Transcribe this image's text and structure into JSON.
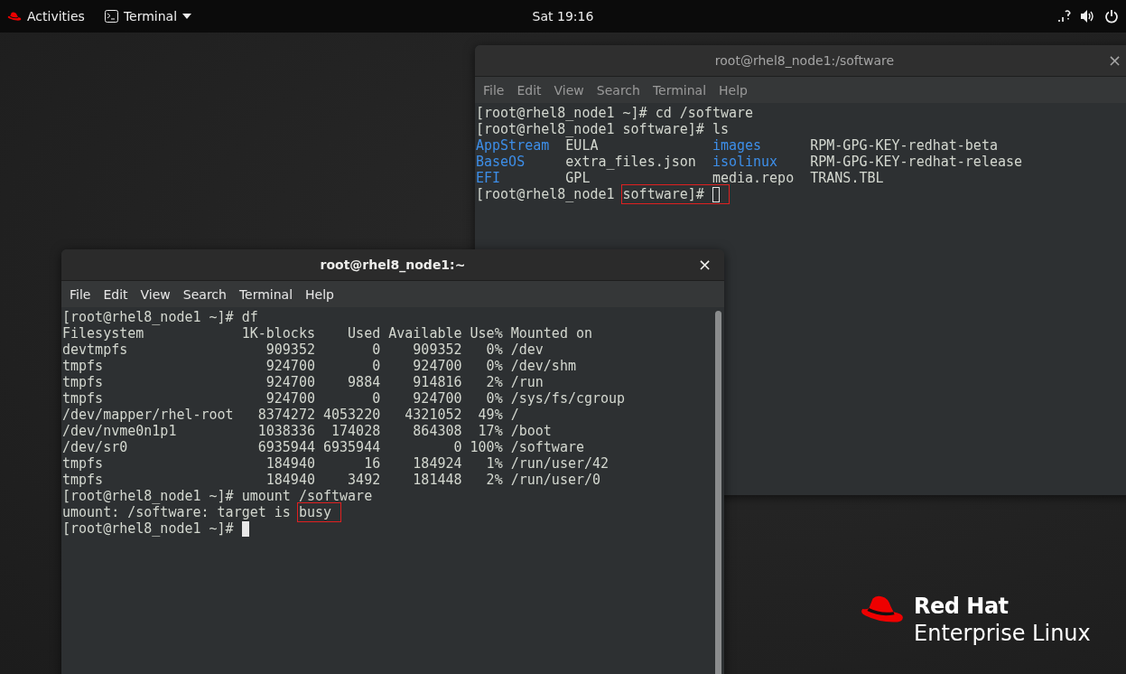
{
  "top_bar": {
    "activities": "Activities",
    "app_menu": "Terminal",
    "clock": "Sat 19:16"
  },
  "windows": [
    {
      "title": "root@rhel8_node1:/software",
      "focused": false,
      "close": "×",
      "menu": [
        "File",
        "Edit",
        "View",
        "Search",
        "Terminal",
        "Help"
      ],
      "lines": [
        {
          "kind": "text",
          "segments": [
            {
              "text": "[root@rhel8_node1 ~]# cd /software",
              "boxed": false
            }
          ]
        },
        {
          "kind": "text",
          "segments": [
            {
              "text": "[root@rhel8_node1 software]# ls",
              "boxed": false
            }
          ]
        },
        {
          "kind": "columns",
          "cells": [
            {
              "text": "AppStream",
              "kind": "dir"
            },
            {
              "text": "EULA",
              "kind": "file"
            },
            {
              "text": "images",
              "kind": "dir"
            },
            {
              "text": "RPM-GPG-KEY-redhat-beta",
              "kind": "file"
            }
          ]
        },
        {
          "kind": "columns",
          "cells": [
            {
              "text": "BaseOS",
              "kind": "dir"
            },
            {
              "text": "extra_files.json",
              "kind": "file"
            },
            {
              "text": "isolinux",
              "kind": "dir"
            },
            {
              "text": "RPM-GPG-KEY-redhat-release",
              "kind": "file"
            }
          ]
        },
        {
          "kind": "columns",
          "cells": [
            {
              "text": "EFI",
              "kind": "dir"
            },
            {
              "text": "GPL",
              "kind": "file"
            },
            {
              "text": "media.repo",
              "kind": "file"
            },
            {
              "text": "TRANS.TBL",
              "kind": "file"
            }
          ]
        },
        {
          "kind": "text",
          "cursor": true,
          "segments": [
            {
              "text": "[root@rhel8_node1",
              "boxed": false
            },
            {
              "text": "software]#",
              "boxed": true
            }
          ]
        }
      ]
    },
    {
      "title": "root@rhel8_node1:~",
      "focused": true,
      "close": "×",
      "menu": [
        "File",
        "Edit",
        "View",
        "Search",
        "Terminal",
        "Help"
      ],
      "lines": [
        {
          "kind": "text",
          "segments": [
            {
              "text": "[root@rhel8_node1 ~]# df",
              "boxed": false
            }
          ]
        },
        {
          "kind": "text",
          "segments": [
            {
              "text": "Filesystem            1K-blocks    Used Available Use% Mounted on",
              "boxed": false
            }
          ]
        },
        {
          "kind": "text",
          "segments": [
            {
              "text": "devtmpfs                 909352       0    909352   0% /dev",
              "boxed": false
            }
          ]
        },
        {
          "kind": "text",
          "segments": [
            {
              "text": "tmpfs                    924700       0    924700   0% /dev/shm",
              "boxed": false
            }
          ]
        },
        {
          "kind": "text",
          "segments": [
            {
              "text": "tmpfs                    924700    9884    914816   2% /run",
              "boxed": false
            }
          ]
        },
        {
          "kind": "text",
          "segments": [
            {
              "text": "tmpfs                    924700       0    924700   0% /sys/fs/cgroup",
              "boxed": false
            }
          ]
        },
        {
          "kind": "text",
          "segments": [
            {
              "text": "/dev/mapper/rhel-root   8374272 4053220   4321052  49% /",
              "boxed": false
            }
          ]
        },
        {
          "kind": "text",
          "segments": [
            {
              "text": "/dev/nvme0n1p1          1038336  174028    864308  17% /boot",
              "boxed": false
            }
          ]
        },
        {
          "kind": "text",
          "segments": [
            {
              "text": "/dev/sr0                6935944 6935944         0 100% /software",
              "boxed": false
            }
          ]
        },
        {
          "kind": "text",
          "segments": [
            {
              "text": "tmpfs                    184940      16    184924   1% /run/user/42",
              "boxed": false
            }
          ]
        },
        {
          "kind": "text",
          "segments": [
            {
              "text": "tmpfs                    184940    3492    181448   2% /run/user/0",
              "boxed": false
            }
          ]
        },
        {
          "kind": "text",
          "segments": [
            {
              "text": "[root@rhel8_node1 ~]# umount /software",
              "boxed": false
            }
          ]
        },
        {
          "kind": "text",
          "segments": [
            {
              "text": "umount: /software: target is",
              "boxed": false
            },
            {
              "text": "busy",
              "boxed": true
            }
          ]
        },
        {
          "kind": "text",
          "cursor": true,
          "segments": [
            {
              "text": "[root@rhel8_node1 ~]#",
              "boxed": false
            }
          ]
        }
      ]
    }
  ],
  "logo": {
    "line_1": "Red Hat",
    "line_2": "Enterprise Linux"
  }
}
